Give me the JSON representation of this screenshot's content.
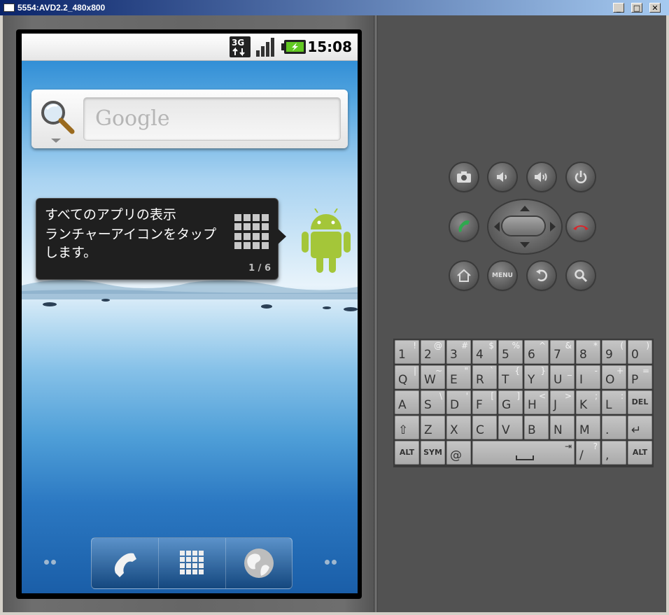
{
  "window": {
    "title": "5554:AVD2.2_480x800",
    "minimize": "_",
    "maximize": "□",
    "close": "✕"
  },
  "statusbar": {
    "network": "3G",
    "time": "15:08"
  },
  "search": {
    "placeholder": "Google"
  },
  "tip": {
    "line1": "すべてのアプリの表示",
    "line2": "ランチャーアイコンをタップ",
    "line3": "します。",
    "page": "1 / 6"
  },
  "dock": {
    "items": [
      "phone-icon",
      "launcher-grid-icon",
      "browser-globe-icon"
    ]
  },
  "hardware": {
    "menu_label": "MENU"
  },
  "keyboard": {
    "rows": [
      [
        [
          "1",
          "!"
        ],
        [
          "2",
          "@"
        ],
        [
          "3",
          "#"
        ],
        [
          "4",
          "$"
        ],
        [
          "5",
          "%"
        ],
        [
          "6",
          "^"
        ],
        [
          "7",
          "&"
        ],
        [
          "8",
          "*"
        ],
        [
          "9",
          "("
        ],
        [
          "0",
          ")"
        ]
      ],
      [
        [
          "Q",
          "|"
        ],
        [
          "W",
          "~"
        ],
        [
          "E",
          "\""
        ],
        [
          "R",
          "`"
        ],
        [
          "T",
          "{"
        ],
        [
          "Y",
          "}"
        ],
        [
          "U",
          "_"
        ],
        [
          "I",
          "-"
        ],
        [
          "O",
          "+"
        ],
        [
          "P",
          "="
        ]
      ],
      [
        [
          "A",
          ""
        ],
        [
          "S",
          "\\"
        ],
        [
          "D",
          "'"
        ],
        [
          "F",
          "["
        ],
        [
          "G",
          "]"
        ],
        [
          "H",
          "<"
        ],
        [
          "J",
          ">"
        ],
        [
          "K",
          ";"
        ],
        [
          "L",
          ":"
        ],
        [
          "DEL",
          ""
        ]
      ],
      [
        [
          "⇧",
          ""
        ],
        [
          "Z",
          ""
        ],
        [
          "X",
          ""
        ],
        [
          "C",
          ""
        ],
        [
          "V",
          ""
        ],
        [
          "B",
          ""
        ],
        [
          "N",
          ""
        ],
        [
          "M",
          ""
        ],
        [
          ".",
          ""
        ],
        [
          "↵",
          ""
        ]
      ]
    ],
    "bottom": {
      "alt_left": "ALT",
      "sym": "SYM",
      "at": "@",
      "tab": "⇥",
      "slash": "/",
      "question": "?",
      "comma": ",",
      "alt_right": "ALT"
    }
  }
}
